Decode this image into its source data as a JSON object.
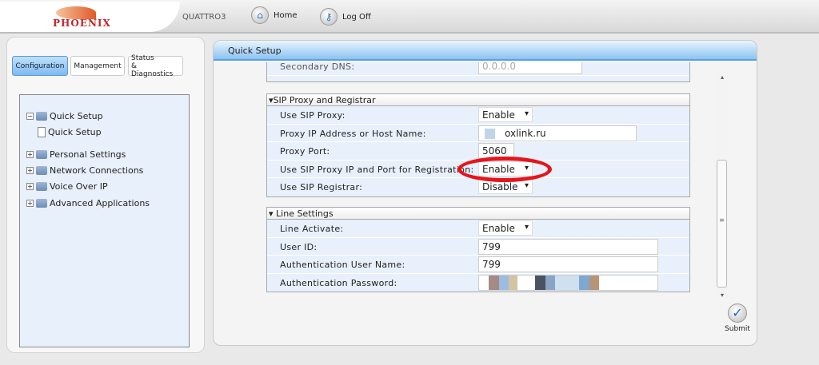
{
  "header": {
    "logo_text": "PHOENIX",
    "device": "QUATTRO3",
    "home": "Home",
    "logoff": "Log Off"
  },
  "tabs": [
    {
      "label": "Configuration"
    },
    {
      "label": "Management"
    },
    {
      "label": "Status\n& Diagnostics",
      "l1": "Status",
      "l2": "& Diagnostics"
    }
  ],
  "tree": {
    "quick_setup": "Quick Setup",
    "quick_setup_child": "Quick Setup",
    "personal": "Personal Settings",
    "network": "Network Connections",
    "voip": "Voice Over IP",
    "advanced": "Advanced Applications"
  },
  "panel_title": "Quick Setup",
  "prev": {
    "label": "Secondary DNS:",
    "value": "0.0.0.0"
  },
  "sip": {
    "title": "SIP Proxy and Registrar",
    "rows": [
      {
        "label": "Use SIP Proxy:",
        "value": "Enable"
      },
      {
        "label": "Proxy IP Address or Host Name:",
        "value": "oxlink.ru"
      },
      {
        "label": "Proxy Port:",
        "value": "5060"
      },
      {
        "label": "Use SIP Proxy IP and Port for Registration:",
        "value": "Enable"
      },
      {
        "label": "Use SIP Registrar:",
        "value": "Disable"
      }
    ]
  },
  "line": {
    "title": "Line Settings",
    "rows": [
      {
        "label": "Line Activate:",
        "value": "Enable"
      },
      {
        "label": "User ID:",
        "value": "799"
      },
      {
        "label": "Authentication User Name:",
        "value": "799"
      },
      {
        "label": "Authentication Password:",
        "value": ""
      }
    ]
  },
  "submit": "Submit",
  "colors": {
    "highlight": "#e8141b",
    "accent": "#5aa0e0"
  }
}
